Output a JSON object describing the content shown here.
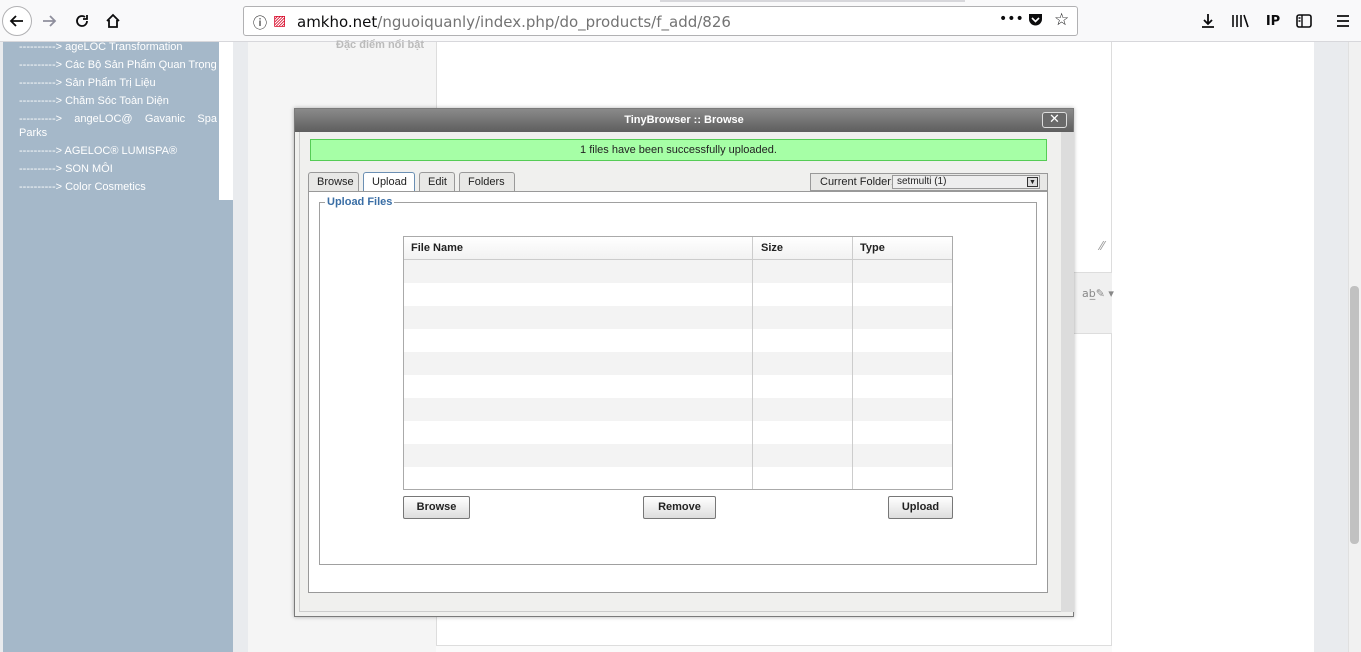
{
  "browser": {
    "url_domain": "amkho.net",
    "url_path": "/nguoiquanly/index.php/do_products/f_add/826",
    "icons": [
      "back-icon",
      "forward-icon",
      "reload-icon",
      "home-icon",
      "info-icon",
      "permissions-icon",
      "page-actions-icon",
      "pocket-icon",
      "bookmark-star-icon",
      "download-icon",
      "library-icon",
      "ip-icon",
      "sidebar-icon",
      "menu-icon"
    ]
  },
  "sidebar": {
    "items": [
      {
        "label": "----------> ageLOC Transformation"
      },
      {
        "label": "----------> Các Bộ Sản Phẩm Quan Trọng"
      },
      {
        "label": "----------> Sản Phẩm Trị Liệu"
      },
      {
        "label": "----------> Chăm Sóc Toàn Diện"
      },
      {
        "label": "----------> angeLOC@ Gavanic Spa Parks"
      },
      {
        "label": "----------> AGELOC® LUMISPA®"
      },
      {
        "label": "----------> SON MÔI"
      },
      {
        "label": "----------> Color Cosmetics"
      }
    ]
  },
  "form": {
    "feature_label": "Đặc điểm nổi bật"
  },
  "dialog": {
    "title": "TinyBrowser :: Browse",
    "close_glyph": "✕",
    "success_message": "1 files have been successfully uploaded.",
    "tabs": [
      {
        "label": "Browse"
      },
      {
        "label": "Upload",
        "active": true
      },
      {
        "label": "Edit"
      },
      {
        "label": "Folders"
      }
    ],
    "current_folder_label": "Current Folder:",
    "current_folder_value": "setmulti (1)",
    "upload_legend": "Upload Files",
    "table": {
      "headers": [
        "File Name",
        "Size",
        "Type"
      ],
      "rows": []
    },
    "buttons": {
      "browse": "Browse",
      "remove": "Remove",
      "upload": "Upload"
    }
  },
  "colors": {
    "success_bg": "#a6ffa6",
    "sidebar_bg": "#a5b8c9",
    "legend_text": "#3a6ea5"
  }
}
